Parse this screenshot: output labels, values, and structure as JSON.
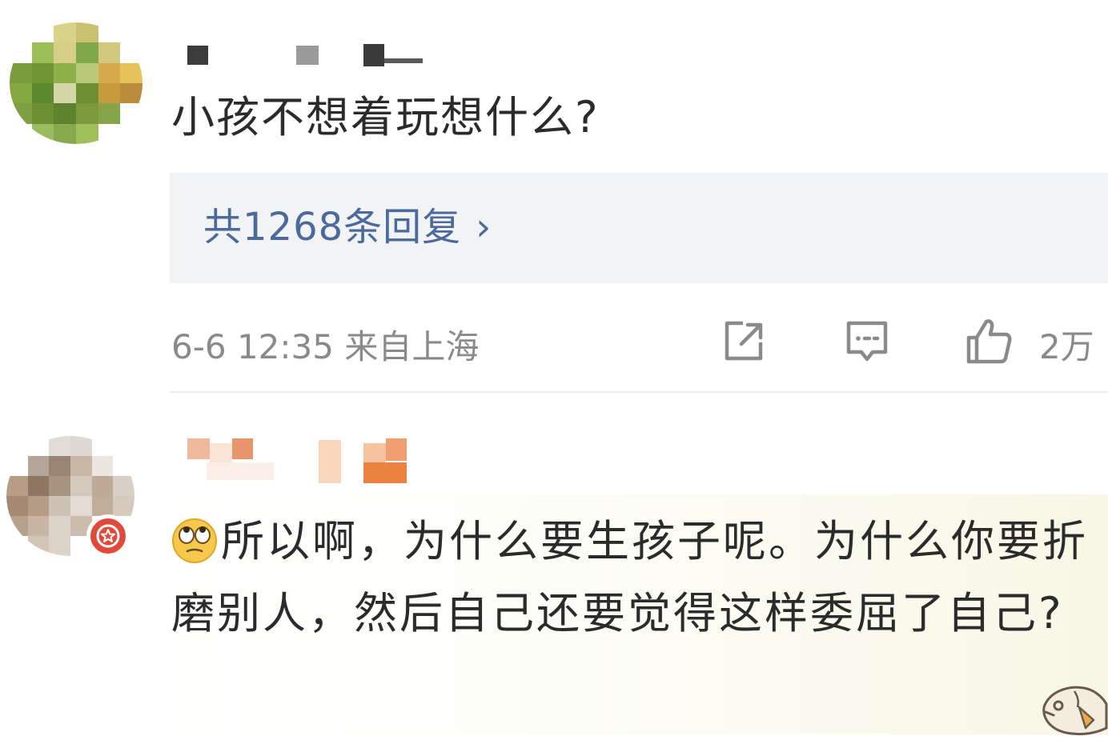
{
  "comments": [
    {
      "text": "小孩不想着玩想什么?",
      "replies_label": "共1268条回复",
      "reply_chevron": "›",
      "timestamp": "6-6 12:35 来自上海",
      "like_count": "2万",
      "icons": [
        "share-icon",
        "comment-icon",
        "thumbs-up-icon"
      ]
    },
    {
      "emoji": "rolling-eyes-emoji",
      "text": "所以啊，为什么要生孩子呢。为什么你要折磨别人，然后自己还要觉得这样委屈了自己?",
      "badge": "vip-star-badge"
    }
  ],
  "colors": {
    "reply_link": "#4c6a9c",
    "meta_text": "#8a8a8a",
    "reply_box_bg": "#f2f3f5",
    "badge_red": "#e14a3a"
  }
}
